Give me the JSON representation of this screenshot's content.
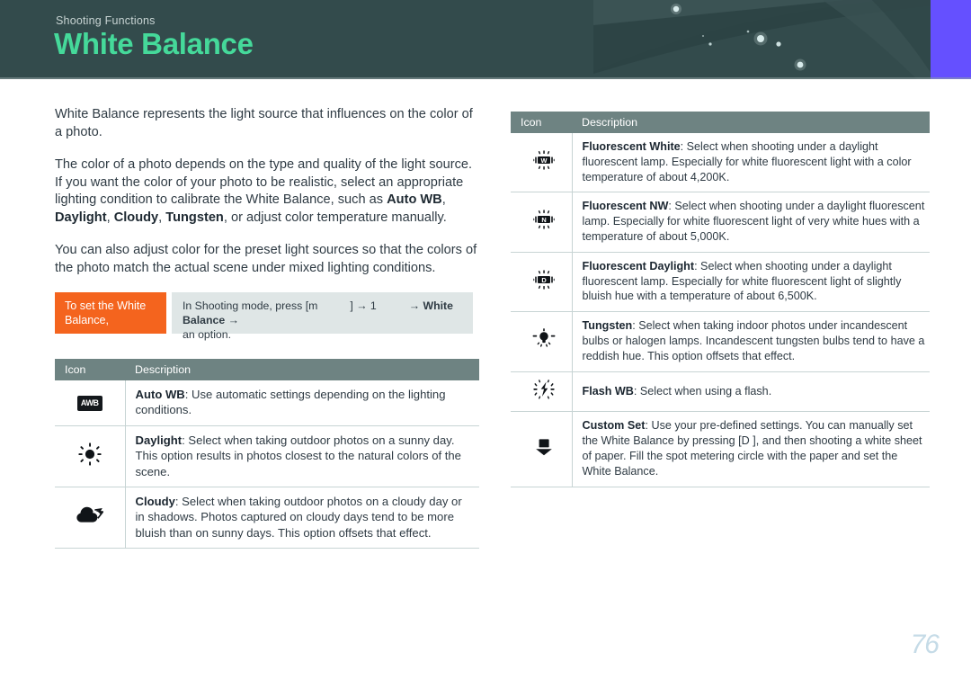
{
  "header": {
    "eyebrow": "Shooting Functions",
    "title": "White Balance",
    "title_color": "#45d99a",
    "band_color": "#334b4c",
    "accent_bar_color": "#6550ff"
  },
  "intro": {
    "p1": "White Balance represents the light source that influences on the color of a photo.",
    "p2_a": "The color of a photo depends on the type and quality of the light source. If you want the color of your photo to be realistic, select an appropriate lighting condition to calibrate the White Balance, such as ",
    "p2_b1": "Auto WB",
    "p2_sep1": ", ",
    "p2_b2": "Daylight",
    "p2_sep2": ", ",
    "p2_b3": "Cloudy",
    "p2_sep3": ", ",
    "p2_b4": "Tungsten",
    "p2_c": ", or adjust color temperature manually.",
    "p3": "You can also adjust color for the preset light sources so that the colors of the photo match the actual scene under mixed lighting conditions."
  },
  "callout": {
    "tag": "To set the White Balance,",
    "body_pre": "In Shooting mode, press [m",
    "body_mid": "] → 1",
    "body_arrow1": "→",
    "body_bold": "White Balance",
    "body_arrow2": "→",
    "body_post": "an option.",
    "tag_bg": "#f4641e",
    "body_bg": "#dfe6e6"
  },
  "table_left": {
    "columns": [
      "Icon",
      "Description"
    ],
    "header_bg": "#6e8382",
    "rows": [
      {
        "icon": "auto-wb-icon",
        "icon_label": "AWB",
        "term": "Auto WB",
        "text": ": Use automatic settings depending on the lighting conditions."
      },
      {
        "icon": "sun-icon",
        "icon_label": "",
        "term": "Daylight",
        "text": ": Select when taking outdoor photos on a sunny day. This option results in photos closest to the natural colors of the scene."
      },
      {
        "icon": "cloud-icon",
        "icon_label": "",
        "term": "Cloudy",
        "text": ": Select when taking outdoor photos on a cloudy day or in shadows. Photos captured on cloudy days tend to be more bluish than on sunny days. This option offsets that effect."
      }
    ]
  },
  "table_right": {
    "columns": [
      "Icon",
      "Description"
    ],
    "header_bg": "#6e8382",
    "rows": [
      {
        "icon": "fluorescent-white-icon",
        "icon_label": "W",
        "term": "Fluorescent White",
        "text": ": Select when shooting under a daylight fluorescent lamp. Especially for white fluorescent light with a color temperature of about 4,200K."
      },
      {
        "icon": "fluorescent-nw-icon",
        "icon_label": "N",
        "term": "Fluorescent NW",
        "text": ": Select when shooting under a daylight fluorescent lamp. Especially for white fluorescent light of very white hues with a temperature of about 5,000K."
      },
      {
        "icon": "fluorescent-daylight-icon",
        "icon_label": "D",
        "term": "Fluorescent Daylight",
        "text": ": Select when shooting under a daylight fluorescent lamp. Especially for white fluorescent light of slightly bluish hue with a temperature of about 6,500K."
      },
      {
        "icon": "tungsten-icon",
        "icon_label": "",
        "term": "Tungsten",
        "text": ": Select when taking indoor photos under incandescent bulbs or halogen lamps. Incandescent tungsten bulbs tend to have a reddish hue. This option offsets that effect."
      },
      {
        "icon": "flash-wb-icon",
        "icon_label": "",
        "term": "Flash WB",
        "text": ": Select when using a flash."
      },
      {
        "icon": "custom-set-icon",
        "icon_label": "",
        "term": "Custom Set",
        "text": ": Use your pre-defined settings. You can manually set the White Balance by pressing [D        ], and then shooting a white sheet of paper. Fill the spot metering circle with the paper and set the White Balance."
      }
    ]
  },
  "footer": {
    "page_number": "76",
    "page_number_color": "#c5dbe7"
  }
}
